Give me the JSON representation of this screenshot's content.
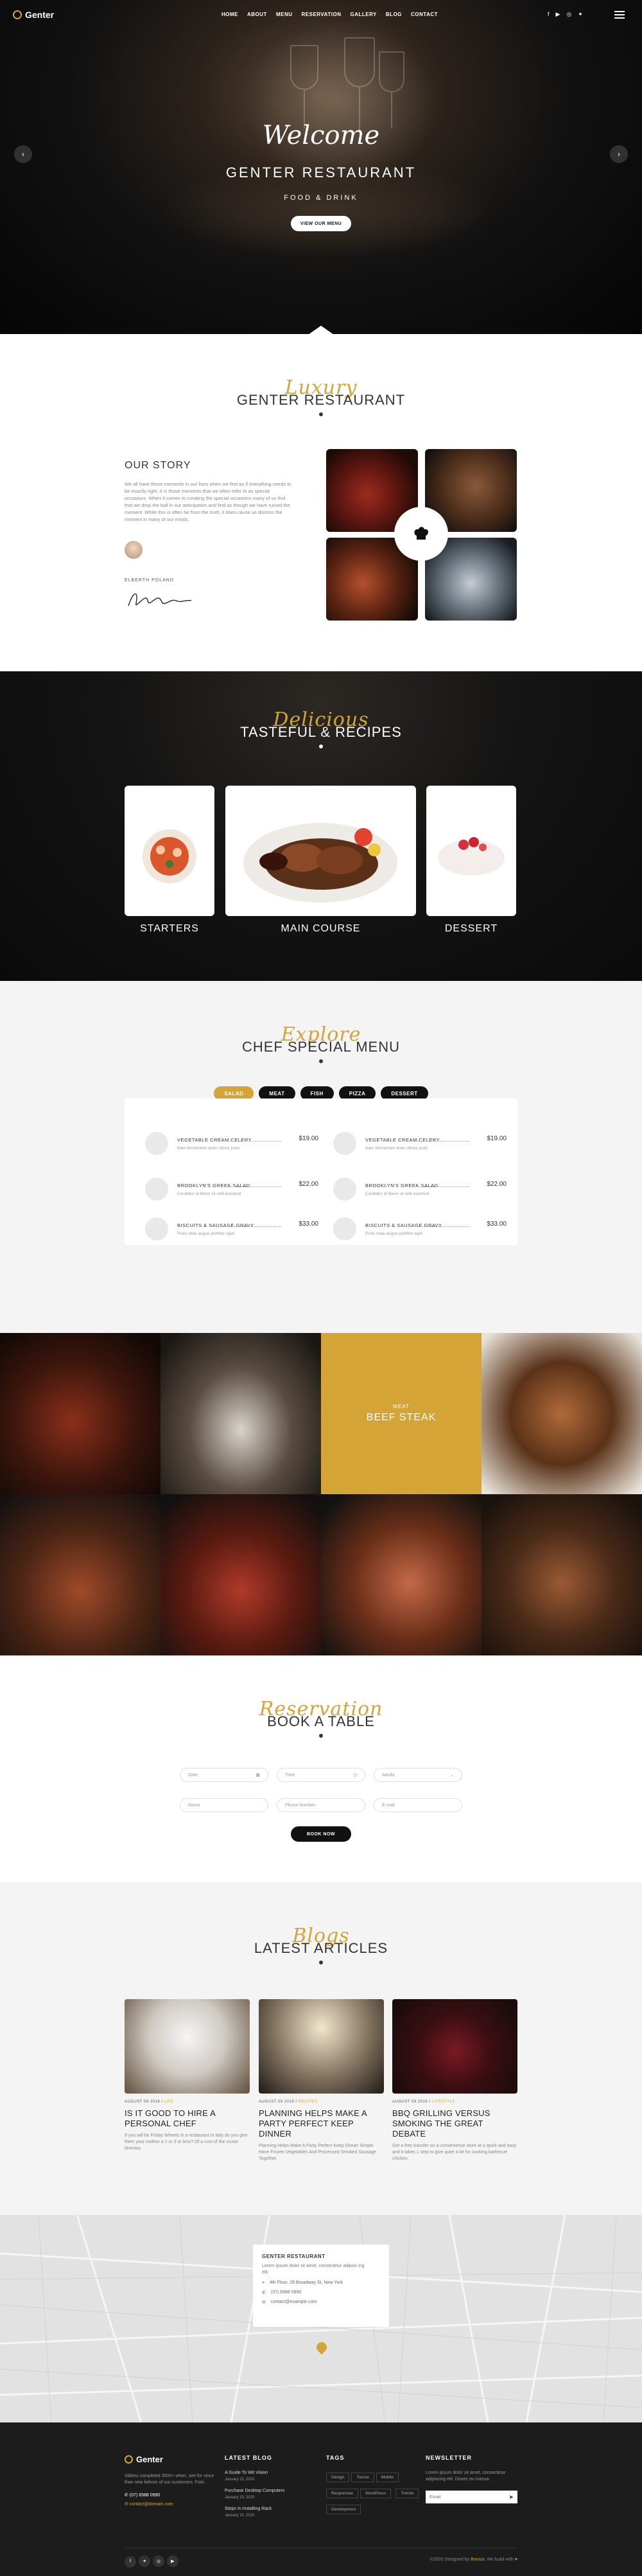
{
  "brand": {
    "name": "Genter",
    "accent": "#d4a437"
  },
  "nav": {
    "items": [
      "HOME",
      "ABOUT",
      "MENU",
      "RESERVATION",
      "GALLERY",
      "BLOG",
      "CONTACT"
    ],
    "social_icons": [
      "facebook-icon",
      "youtube-icon",
      "instagram-icon",
      "twitter-icon"
    ]
  },
  "hero": {
    "welcome": "Welcome",
    "title": "GENTER RESTAURANT",
    "subtitle": "FOOD & DRINK",
    "button": "VIEW OUR MENU"
  },
  "about": {
    "script": "Luxury",
    "title": "GENTER RESTAURANT",
    "story_title": "OUR STORY",
    "story_text": "We all have those moments in our lives when we feel as if everything needs to be exactly right. It is those moments that we often refer to as special occasions. When it comes to creating the special occasions many of us find that we drop the ball in our anticipation and find as though we have ruined the moment. While this is often far from the truth, it does cause us dismiss the moment in many of our minds.",
    "chef_name": "ELBERTH POLAND"
  },
  "recipes": {
    "script": "Delicious",
    "title": "TASTEFUL & RECIPES",
    "cards": [
      "STARTERS",
      "MAIN COURSE",
      "DESSERT"
    ]
  },
  "special_menu": {
    "script": "Explore",
    "title": "CHEF SPECIAL MENU",
    "tabs": [
      "SALAD",
      "MEAT",
      "FISH",
      "PIZZA",
      "DESSERT"
    ],
    "items": [
      {
        "name": "VEGETABLE CREAM CELERY",
        "price": "$19.00",
        "desc": "Nam fermentum enim ultrice justo"
      },
      {
        "name": "VEGETABLE CREAM CELERY",
        "price": "$19.00",
        "desc": "Nam fermentum enim ultrice justo"
      },
      {
        "name": "BROOKLYN'S GREEK SALAD",
        "price": "$22.00",
        "desc": "Curabitur id libero sit velit euismod"
      },
      {
        "name": "BROOKLYN'S GREEK SALAD",
        "price": "$22.00",
        "desc": "Curabitur id libero sit velit euismod"
      },
      {
        "name": "BISCUITS & SAUSAGE GRAVY",
        "price": "$33.00",
        "desc": "Proin vitae augue porttitor eget"
      },
      {
        "name": "BISCUITS & SAUSAGE GRAVY",
        "price": "$33.00",
        "desc": "Proin vitae augue porttitor eget"
      }
    ]
  },
  "gallery": {
    "feature_kicker": "MEAT",
    "feature_title": "BEEF STEAK"
  },
  "book": {
    "script": "Reservation",
    "title": "BOOK A TABLE",
    "fields": [
      "Date",
      "Time",
      "Adults",
      "Name",
      "Phone Number",
      "E-mail"
    ],
    "button": "BOOK NOW"
  },
  "blog": {
    "script": "Blogs",
    "title": "LATEST ARTICLES",
    "posts": [
      {
        "meta_date": "AUGUST 09 2019 /",
        "meta_tag": "LIFE",
        "title": "IS IT GOOD TO HIRE A PERSONAL CHEF",
        "excerpt": "If you will be Friday Wheels in a restaurant in Italy do you give them your mother a 2 or 3 or less? Of a cost of the cruise itinerary."
      },
      {
        "meta_date": "AUGUST 09 2019 /",
        "meta_tag": "RECIPES",
        "title": "PLANNING HELPS MAKE A PARTY PERFECT KEEP DINNER",
        "excerpt": "Planning Helps Make A Party Perfect Keep Dinner Simple Have Frozen Vegetables And Processed Smoked Sausage Together."
      },
      {
        "meta_date": "AUGUST 09 2019 /",
        "meta_tag": "LIFESTYLE",
        "title": "BBQ GRILLING VERSUS SMOKING THE GREAT DEBATE",
        "excerpt": "Get a free transfer on a convenience store at a quick and easy and it takes 1 step to give quite a bit for cooking barbecue chicken."
      }
    ]
  },
  "map_card": {
    "title": "GENTER RESTAURANT",
    "desc": "Lorem ipsum dolor sit amet, consectetur adipisc ing elit.",
    "address": "4th Floor, 29 Broadway St, New York",
    "phone": "(07) 6588 0990",
    "email": "contact@example.com"
  },
  "footer": {
    "about": "Sibkeu completed 3000+ when, see for since than new fathom of our customers. Fork.",
    "phone": "(07) 6588 0990",
    "email": "contact@domain.com",
    "blog_title": "LATEST BLOG",
    "blog_items": [
      {
        "title": "A Guide To Wit Vision",
        "date": "January 15, 2020"
      },
      {
        "title": "Purchase Desktop Computers",
        "date": "January 15, 2020"
      },
      {
        "title": "Steps In Installing Rack",
        "date": "January 15, 2020"
      }
    ],
    "tags_title": "TAGS",
    "tags": [
      "Design",
      "Tourse",
      "Mobile",
      "Responsive",
      "WordPress",
      "Trends",
      "Development"
    ],
    "newsletter_title": "NEWSLETTER",
    "newsletter_text": "Lorem ipsum dolor sit amet, consectetur adipiscing elit. Donec eu massa.",
    "email_placeholder": "Email",
    "copyright_pre": "©2020 Designed by",
    "copyright_brand": "Bonisa",
    "copyright_post": ". We build with"
  }
}
